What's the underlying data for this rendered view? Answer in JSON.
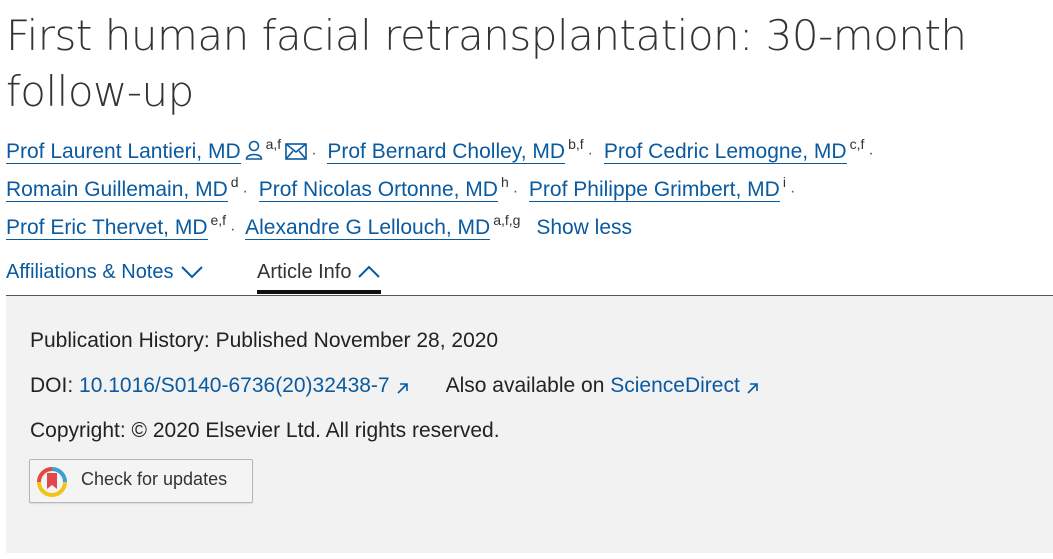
{
  "article": {
    "title": "First human facial retransplantation: 30-month follow-up"
  },
  "authors": [
    {
      "name": "Prof Laurent Lantieri, MD",
      "sup": "a,f"
    },
    {
      "name": "Prof Bernard Cholley, MD",
      "sup": "b,f"
    },
    {
      "name": "Prof Cedric Lemogne, MD",
      "sup": "c,f"
    },
    {
      "name": "Romain Guillemain, MD",
      "sup": "d"
    },
    {
      "name": "Prof Nicolas Ortonne, MD",
      "sup": "h"
    },
    {
      "name": "Prof Philippe Grimbert, MD",
      "sup": "i"
    },
    {
      "name": "Prof Eric Thervet, MD",
      "sup": "e,f"
    },
    {
      "name": "Alexandre G Lellouch, MD",
      "sup": "a,f,g"
    }
  ],
  "separator": "·",
  "show_less": "Show less",
  "tabs": {
    "affiliations": "Affiliations & Notes",
    "article_info": "Article Info"
  },
  "info": {
    "history_label": "Publication History:",
    "history_value": "Published November 28, 2020",
    "doi_label": "DOI:",
    "doi_value": "10.1016/S0140-6736(20)32438-7",
    "also_label": "Also available on",
    "also_value": "ScienceDirect",
    "copyright": "Copyright: © 2020 Elsevier Ltd. All rights reserved."
  },
  "badge": {
    "label": "Check for updates"
  },
  "icons": {
    "corresponding": "person-icon",
    "email": "envelope-icon",
    "external": "external-link-icon",
    "chevron": "chevron-down-icon",
    "chevron_up": "chevron-up-icon"
  },
  "colors": {
    "link": "#0a5aa0",
    "panel": "#f2f2f2"
  }
}
